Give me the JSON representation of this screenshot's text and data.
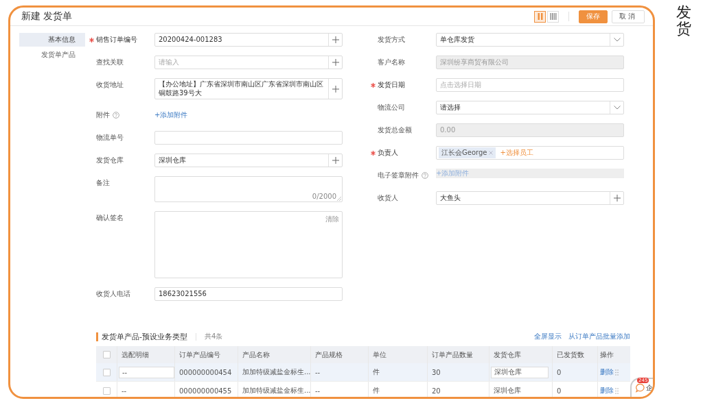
{
  "window": {
    "title": "新建 发货单"
  },
  "view_toggle": [
    {
      "kind": "two-column",
      "selected": true
    },
    {
      "kind": "four-column",
      "selected": false
    }
  ],
  "buttons": [
    {
      "label": "保存",
      "kind": "primary"
    },
    {
      "label": "取消",
      "kind": "default"
    }
  ],
  "nav": [
    {
      "label": "基本信息",
      "selected": true
    },
    {
      "label": "发货单产品",
      "selected": false
    }
  ],
  "left_fields": [
    {
      "label": "销售订单编号",
      "required": true,
      "help": false,
      "disabled": false,
      "kind": "input-plus",
      "value": "20200424-001283"
    },
    {
      "label": "查找关联",
      "required": false,
      "help": false,
      "disabled": false,
      "kind": "input-plus",
      "placeholder": "请输入"
    },
    {
      "label": "收货地址",
      "required": false,
      "help": false,
      "disabled": false,
      "kind": "input-plus",
      "value": "【办公地址】广东省深圳市南山区广东省深圳市南山区铜鼓路39号大"
    },
    {
      "label": "附件",
      "required": false,
      "help": true,
      "disabled": false,
      "kind": "link",
      "value": "+添加附件"
    },
    {
      "label": "物流单号",
      "required": false,
      "help": false,
      "disabled": false,
      "kind": "input"
    },
    {
      "label": "发货仓库",
      "required": false,
      "help": false,
      "disabled": false,
      "kind": "input-plus",
      "value": "深圳仓库"
    },
    {
      "label": "备注",
      "required": false,
      "help": false,
      "disabled": false,
      "kind": "textarea",
      "counter": "0/2000"
    },
    {
      "label": "确认签名",
      "required": false,
      "help": false,
      "disabled": false,
      "kind": "signature",
      "action": "清除"
    },
    {
      "label": "收货人电话",
      "required": false,
      "help": false,
      "disabled": false,
      "kind": "input",
      "value": "18623021556"
    }
  ],
  "right_fields": [
    {
      "label": "发货方式",
      "required": false,
      "help": false,
      "disabled": false,
      "kind": "select",
      "value": "单仓库发货"
    },
    {
      "label": "客户名称",
      "required": false,
      "help": false,
      "disabled": true,
      "kind": "input",
      "value": "深圳纷享商贸有限公司"
    },
    {
      "label": "发货日期",
      "required": true,
      "help": false,
      "disabled": false,
      "kind": "input",
      "placeholder": "点击选择日期"
    },
    {
      "label": "物流公司",
      "required": false,
      "help": false,
      "disabled": false,
      "kind": "select",
      "value": "请选择"
    },
    {
      "label": "发货总金额",
      "required": false,
      "help": false,
      "disabled": true,
      "kind": "input",
      "value": "0.00"
    },
    {
      "label": "负责人",
      "required": true,
      "help": false,
      "disabled": false,
      "kind": "tags",
      "tags": [
        "江长会George"
      ],
      "value": "+选择员工"
    },
    {
      "label": "电子签章附件",
      "required": false,
      "help": true,
      "disabled": true,
      "kind": "link",
      "value": "+添加附件"
    },
    {
      "label": "收货人",
      "required": false,
      "help": false,
      "disabled": false,
      "kind": "input-plus",
      "value": "大鱼头"
    }
  ],
  "products": {
    "title": "发货单产品-预设业务类型",
    "count": "共4条",
    "actions": [
      "全屏显示",
      "从订单产品批量添加"
    ],
    "header_checked": false,
    "columns": [
      "选配明细",
      "订单产品编号",
      "产品名称",
      "产品规格",
      "单位",
      "订单产品数量",
      "发货仓库",
      "已发货数",
      "操作"
    ],
    "rows": [
      {
        "checked": false,
        "highlighted": true,
        "editing": true,
        "cells": [
          "--",
          "000000000454",
          "加加特级减盐金标生...",
          "--",
          "件",
          "30",
          "深圳仓库",
          "0",
          "删除"
        ]
      },
      {
        "checked": false,
        "highlighted": false,
        "editing": false,
        "cells": [
          "--",
          "000000000455",
          "加加特级减盐金标生...",
          "--",
          "件",
          "20",
          "深圳仓库",
          "0",
          "删除"
        ]
      }
    ]
  },
  "chat_widget": {
    "badge": "245",
    "label": "企"
  },
  "side_caption": "发货"
}
